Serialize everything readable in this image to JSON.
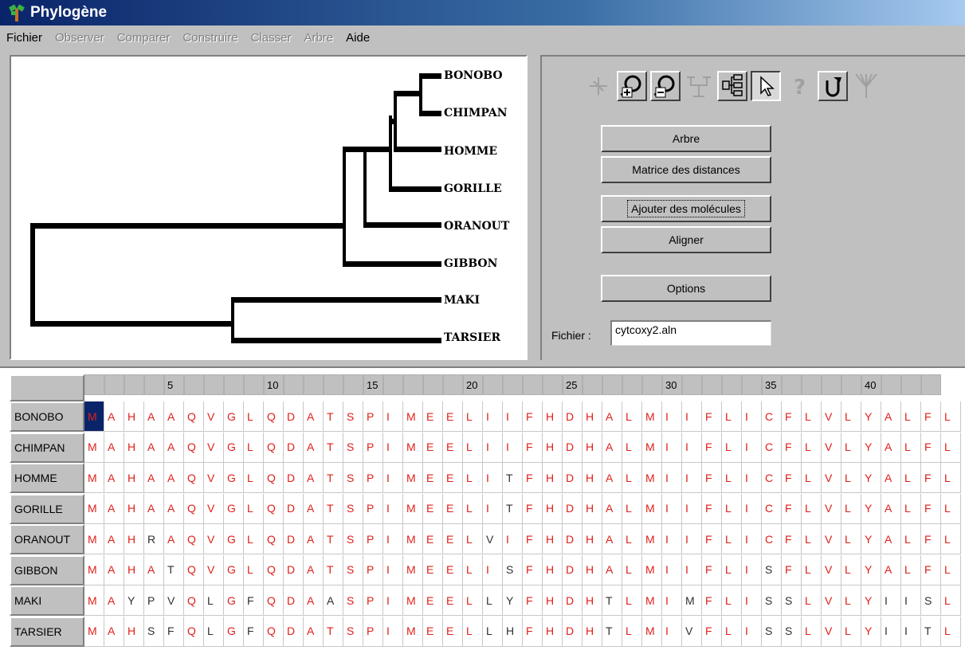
{
  "window": {
    "title": "Phylogène"
  },
  "menu": [
    {
      "label": "Fichier",
      "enabled": true
    },
    {
      "label": "Observer",
      "enabled": false
    },
    {
      "label": "Comparer",
      "enabled": false
    },
    {
      "label": "Construire",
      "enabled": false
    },
    {
      "label": "Classer",
      "enabled": false
    },
    {
      "label": "Arbre",
      "enabled": false
    },
    {
      "label": "Aide",
      "enabled": true
    }
  ],
  "tree": {
    "leaves": [
      "BONOBO",
      "CHIMPAN",
      "HOMME",
      "GORILLE",
      "ORANOUT",
      "GIBBON",
      "MAKI",
      "TARSIER"
    ]
  },
  "toolbar": {
    "icons": [
      "select-branch-icon",
      "zoom-in-icon",
      "zoom-out-icon",
      "collapse-tree-icon",
      "expand-tree-icon",
      "pointer-icon",
      "help-icon",
      "rotate-icon",
      "spread-tree-icon"
    ]
  },
  "buttons": {
    "arbre": "Arbre",
    "matrice": "Matrice des distances",
    "ajouter": "Ajouter des molécules",
    "aligner": "Aligner",
    "options": "Options"
  },
  "file": {
    "label": "Fichier :",
    "value": "cytcoxy2.aln"
  },
  "alignment": {
    "column_numbers": [
      "",
      "",
      "",
      "",
      "5",
      "",
      "",
      "",
      "",
      "10",
      "",
      "",
      "",
      "",
      "15",
      "",
      "",
      "",
      "",
      "20",
      "",
      "",
      "",
      "",
      "25",
      "",
      "",
      "",
      "",
      "30",
      "",
      "",
      "",
      "",
      "35",
      "",
      "",
      "",
      "",
      "40",
      "",
      "",
      ""
    ],
    "rows": [
      {
        "name": "BONOBO",
        "seq": "MAHAAQVGLQDATSPIMEELIIFHDHALMIIFLICFLVLYALFL"
      },
      {
        "name": "CHIMPAN",
        "seq": "MAHAAQVGLQDATSPIMEELIIFHDHALMIIFLICFLVLYALFL"
      },
      {
        "name": "HOMME",
        "seq": "MAHAAQVGLQDATSPIMEELITFHDHALMIIFLICFLVLYALFL"
      },
      {
        "name": "GORILLE",
        "seq": "MAHAAQVGLQDATSPIMEELITFHDHALMIIFLICFLVLYALFL"
      },
      {
        "name": "ORANOUT",
        "seq": "MAHRAQVGLQDATSPIMEELVIFHDHALMIIFLICFLVLYALFL"
      },
      {
        "name": "GIBBON",
        "seq": "MAHATQVGLQDATSPIMEELISFHDHALMIIFLISFLVLYALFL"
      },
      {
        "name": "MAKI",
        "seq": "MAYPVQLGFQDAASPIMEELLYFHDHTLMIMFLISSLVLYIISL"
      },
      {
        "name": "TARSIER",
        "seq": "MAHSFQLGFQDATSPIMEELLHFHDHTLMIVFLISSLVLYIITL"
      }
    ],
    "colors": {
      "conserved": "#e0201a",
      "variable": "#303030",
      "selected_bg": "#0a246a"
    }
  }
}
